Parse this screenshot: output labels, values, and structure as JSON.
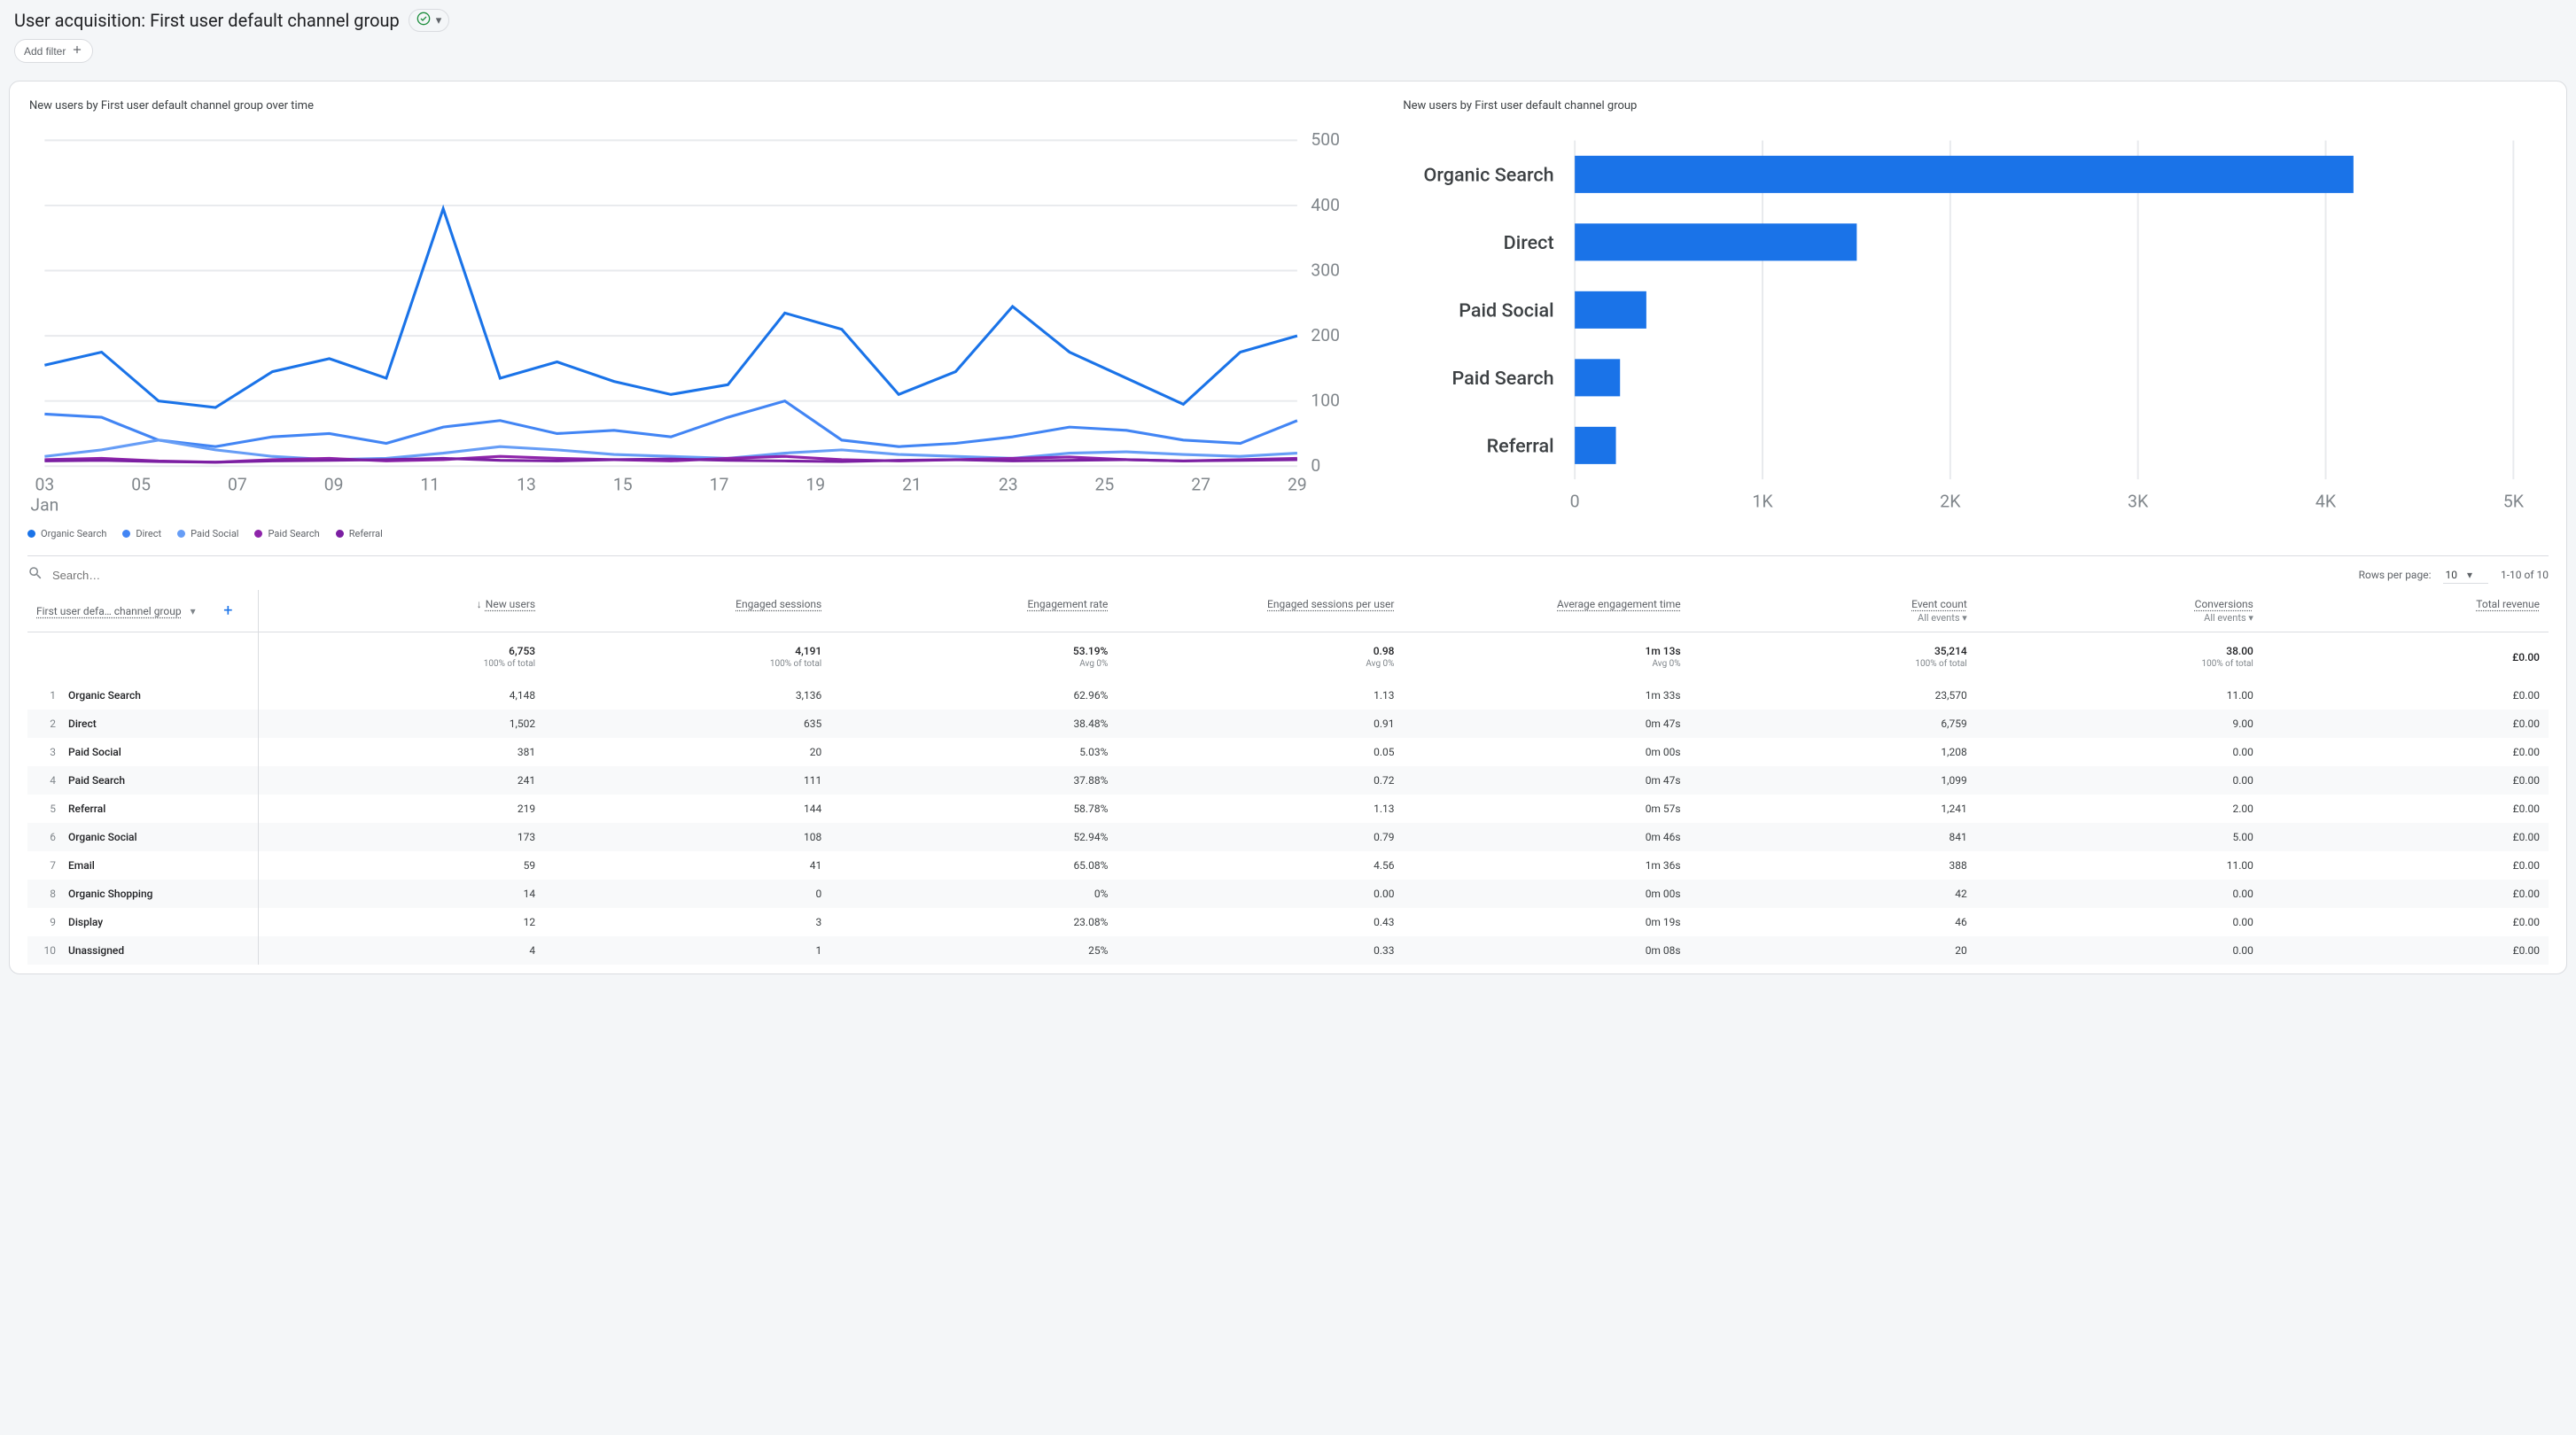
{
  "header": {
    "title": "User acquisition: First user default channel group",
    "add_filter_label": "Add filter"
  },
  "charts": {
    "line": {
      "title": "New users by First user default channel group over time"
    },
    "bar": {
      "title": "New users by First user default channel group"
    }
  },
  "chart_data": [
    {
      "type": "line",
      "title": "New users by First user default channel group over time",
      "x": [
        "03",
        "05",
        "07",
        "09",
        "11",
        "13",
        "15",
        "17",
        "19",
        "21",
        "23",
        "25",
        "27",
        "29"
      ],
      "x_sublabel": "Jan",
      "ylim": [
        0,
        500
      ],
      "yticks": [
        0,
        100,
        200,
        300,
        400,
        500
      ],
      "series": [
        {
          "name": "Organic Search",
          "color": "#1a73e8",
          "values": [
            155,
            175,
            100,
            90,
            145,
            165,
            135,
            395,
            135,
            160,
            130,
            110,
            125,
            235,
            210,
            110,
            145,
            245,
            175,
            135,
            95,
            175,
            200
          ]
        },
        {
          "name": "Direct",
          "color": "#4285f4",
          "values": [
            80,
            75,
            40,
            30,
            45,
            50,
            35,
            60,
            70,
            50,
            55,
            45,
            75,
            100,
            40,
            30,
            35,
            45,
            60,
            55,
            40,
            35,
            70
          ]
        },
        {
          "name": "Paid Social",
          "color": "#669df6",
          "values": [
            15,
            25,
            40,
            25,
            15,
            10,
            12,
            20,
            30,
            25,
            18,
            15,
            12,
            20,
            25,
            18,
            15,
            12,
            20,
            22,
            18,
            15,
            20
          ]
        },
        {
          "name": "Paid Search",
          "color": "#8e24aa",
          "values": [
            10,
            12,
            8,
            6,
            10,
            12,
            8,
            10,
            15,
            12,
            10,
            8,
            12,
            15,
            10,
            8,
            10,
            12,
            14,
            10,
            8,
            10,
            12
          ]
        },
        {
          "name": "Referral",
          "color": "#7b1fa2",
          "values": [
            8,
            9,
            7,
            6,
            8,
            9,
            10,
            12,
            9,
            8,
            10,
            11,
            9,
            8,
            7,
            9,
            10,
            8,
            9,
            10,
            8,
            9,
            10
          ]
        }
      ]
    },
    {
      "type": "bar",
      "title": "New users by First user default channel group",
      "orientation": "horizontal",
      "xlabel": "",
      "xlim": [
        0,
        5000
      ],
      "xticks": [
        0,
        1000,
        2000,
        3000,
        4000,
        5000
      ],
      "xtick_labels": [
        "0",
        "1K",
        "2K",
        "3K",
        "4K",
        "5K"
      ],
      "categories": [
        "Organic Search",
        "Direct",
        "Paid Social",
        "Paid Search",
        "Referral"
      ],
      "values": [
        4148,
        1502,
        381,
        241,
        219
      ],
      "color": "#1a73e8"
    }
  ],
  "line_legend": [
    {
      "name": "Organic Search",
      "color": "#1a73e8"
    },
    {
      "name": "Direct",
      "color": "#4285f4"
    },
    {
      "name": "Paid Social",
      "color": "#669df6"
    },
    {
      "name": "Paid Search",
      "color": "#8e24aa"
    },
    {
      "name": "Referral",
      "color": "#7b1fa2"
    }
  ],
  "toolbar": {
    "search_placeholder": "Search…",
    "rows_per_page_label": "Rows per page:",
    "rows_per_page_value": "10",
    "range_text": "1-10 of 10"
  },
  "table": {
    "dimension_header": "First user defa… channel group",
    "columns": [
      {
        "key": "new_users",
        "label": "New users",
        "sorted": "desc"
      },
      {
        "key": "engaged_sessions",
        "label": "Engaged sessions"
      },
      {
        "key": "engagement_rate",
        "label": "Engagement rate"
      },
      {
        "key": "esp_user",
        "label": "Engaged sessions per user"
      },
      {
        "key": "avg_eng_time",
        "label": "Average engagement time"
      },
      {
        "key": "event_count",
        "label": "Event count",
        "sub": "All events"
      },
      {
        "key": "conversions",
        "label": "Conversions",
        "sub": "All events"
      },
      {
        "key": "total_revenue",
        "label": "Total revenue"
      }
    ],
    "summary": {
      "new_users": {
        "v": "6,753",
        "sub": "100% of total"
      },
      "engaged_sessions": {
        "v": "4,191",
        "sub": "100% of total"
      },
      "engagement_rate": {
        "v": "53.19%",
        "sub": "Avg 0%"
      },
      "esp_user": {
        "v": "0.98",
        "sub": "Avg 0%"
      },
      "avg_eng_time": {
        "v": "1m 13s",
        "sub": "Avg 0%"
      },
      "event_count": {
        "v": "35,214",
        "sub": "100% of total"
      },
      "conversions": {
        "v": "38.00",
        "sub": "100% of total"
      },
      "total_revenue": {
        "v": "£0.00",
        "sub": ""
      }
    },
    "rows": [
      {
        "idx": "1",
        "name": "Organic Search",
        "new_users": "4,148",
        "engaged_sessions": "3,136",
        "engagement_rate": "62.96%",
        "esp_user": "1.13",
        "avg_eng_time": "1m 33s",
        "event_count": "23,570",
        "conversions": "11.00",
        "total_revenue": "£0.00"
      },
      {
        "idx": "2",
        "name": "Direct",
        "new_users": "1,502",
        "engaged_sessions": "635",
        "engagement_rate": "38.48%",
        "esp_user": "0.91",
        "avg_eng_time": "0m 47s",
        "event_count": "6,759",
        "conversions": "9.00",
        "total_revenue": "£0.00"
      },
      {
        "idx": "3",
        "name": "Paid Social",
        "new_users": "381",
        "engaged_sessions": "20",
        "engagement_rate": "5.03%",
        "esp_user": "0.05",
        "avg_eng_time": "0m 00s",
        "event_count": "1,208",
        "conversions": "0.00",
        "total_revenue": "£0.00"
      },
      {
        "idx": "4",
        "name": "Paid Search",
        "new_users": "241",
        "engaged_sessions": "111",
        "engagement_rate": "37.88%",
        "esp_user": "0.72",
        "avg_eng_time": "0m 47s",
        "event_count": "1,099",
        "conversions": "0.00",
        "total_revenue": "£0.00"
      },
      {
        "idx": "5",
        "name": "Referral",
        "new_users": "219",
        "engaged_sessions": "144",
        "engagement_rate": "58.78%",
        "esp_user": "1.13",
        "avg_eng_time": "0m 57s",
        "event_count": "1,241",
        "conversions": "2.00",
        "total_revenue": "£0.00"
      },
      {
        "idx": "6",
        "name": "Organic Social",
        "new_users": "173",
        "engaged_sessions": "108",
        "engagement_rate": "52.94%",
        "esp_user": "0.79",
        "avg_eng_time": "0m 46s",
        "event_count": "841",
        "conversions": "5.00",
        "total_revenue": "£0.00"
      },
      {
        "idx": "7",
        "name": "Email",
        "new_users": "59",
        "engaged_sessions": "41",
        "engagement_rate": "65.08%",
        "esp_user": "4.56",
        "avg_eng_time": "1m 36s",
        "event_count": "388",
        "conversions": "11.00",
        "total_revenue": "£0.00"
      },
      {
        "idx": "8",
        "name": "Organic Shopping",
        "new_users": "14",
        "engaged_sessions": "0",
        "engagement_rate": "0%",
        "esp_user": "0.00",
        "avg_eng_time": "0m 00s",
        "event_count": "42",
        "conversions": "0.00",
        "total_revenue": "£0.00"
      },
      {
        "idx": "9",
        "name": "Display",
        "new_users": "12",
        "engaged_sessions": "3",
        "engagement_rate": "23.08%",
        "esp_user": "0.43",
        "avg_eng_time": "0m 19s",
        "event_count": "46",
        "conversions": "0.00",
        "total_revenue": "£0.00"
      },
      {
        "idx": "10",
        "name": "Unassigned",
        "new_users": "4",
        "engaged_sessions": "1",
        "engagement_rate": "25%",
        "esp_user": "0.33",
        "avg_eng_time": "0m 08s",
        "event_count": "20",
        "conversions": "0.00",
        "total_revenue": "£0.00"
      }
    ]
  }
}
